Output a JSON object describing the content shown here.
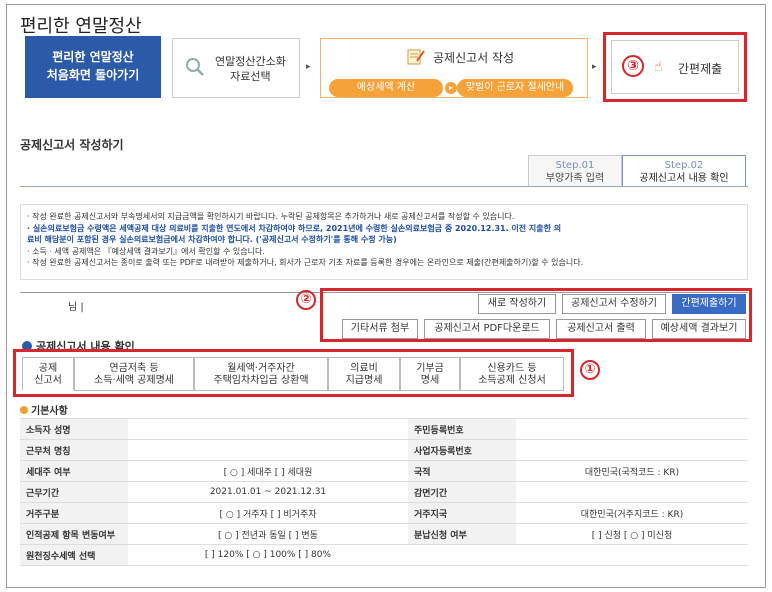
{
  "app_title": "편리한 연말정산",
  "home_button": {
    "line1": "편리한 연말정산",
    "line2": "처음화면 돌아가기"
  },
  "steps": {
    "step1": {
      "line1": "연말정산간소화",
      "line2": "자료선택",
      "icon": "magnifier-icon"
    },
    "step2": {
      "label": "공제신고서 작성",
      "sub1": "예상세액 계산",
      "sub2": "맞벌이 근로자 절세안내",
      "icon": "memo-icon"
    },
    "step3": {
      "num": "③",
      "label": "간편제출",
      "icon": "hand-pointer-icon"
    }
  },
  "arrow_glyph": "▸",
  "section_title": "공제신고서 작성하기",
  "tabs": [
    {
      "step": "Step.01",
      "label": "부양가족 입력"
    },
    {
      "step": "Step.02",
      "label": "공제신고서 내용 확인"
    }
  ],
  "notice": {
    "line1": "· 작성 완료한 공제신고서와 부속명세서의 지급금액을 확인하시기 바랍니다. 누락된 공제항목은 추가하거나 새로 공제신고서를 작성할 수 있습니다.",
    "line2": "· 실손의료보험금 수령액은 세액공제 대상 의료비를 지출한 연도에서 차감하여야 하므로, 2021년에 수령한 실손의료보험금 중 2020.12.31. 이전 지출한 의",
    "line3": "  료비 해당분이 포함된 경우 실손의료보험금에서 차감하여야 합니다. ('공제신고서 수정하기'를 통해 수정 가능)",
    "line4": "· 소득 · 세액 공제액은 『예상세액 결과보기』에서 확인할 수 있습니다.",
    "line5": "· 작성 완료한 공제신고서는 종이로 출력 또는 PDF로 내려받아 제출하거나, 회사가 근로자 기초 자료를 등록한 경우에는 온라인으로 제출(간편제출하기)할 수 있습니다."
  },
  "user_suffix": "님 |",
  "buttons_row1": [
    "새로 작성하기",
    "공제신고서 수정하기",
    "간편제출하기"
  ],
  "buttons_row2": [
    "기타서류 첨부",
    "공제신고서 PDF다운로드",
    "공제신고서 출력",
    "예상세액 결과보기"
  ],
  "marker2": "②",
  "marker1": "①",
  "sub_title": "공제신고서 내용 확인",
  "detail_tabs": [
    {
      "l1": "공제",
      "l2": "신고서"
    },
    {
      "l1": "연금저축 등",
      "l2": "소득·세액 공제명세"
    },
    {
      "l1": "월세액·거주자간",
      "l2": "주택임차차입금 상환액"
    },
    {
      "l1": "의료비",
      "l2": "지급명세"
    },
    {
      "l1": "기부금",
      "l2": "명세"
    },
    {
      "l1": "신용카드 등",
      "l2": "소득공제 신청서"
    }
  ],
  "basic_title": "기본사항",
  "info_rows": [
    {
      "h1": "소득자 성명",
      "v1": "",
      "h2": "주민등록번호",
      "v2": ""
    },
    {
      "h1": "근무처 명칭",
      "v1": "",
      "h2": "사업자등록번호",
      "v2": ""
    },
    {
      "h1": "세대주 여부",
      "v1": "[ ○ ] 세대주  [  ] 세대원",
      "h2": "국적",
      "v2": "대한민국(국적코드 : KR)"
    },
    {
      "h1": "근무기간",
      "v1": "2021.01.01 ~ 2021.12.31",
      "h2": "감면기간",
      "v2": ""
    },
    {
      "h1": "거주구분",
      "v1": "[ ○ ] 거주자  [  ] 비거주자",
      "h2": "거주지국",
      "v2": "대한민국(거주지코드 : KR)"
    },
    {
      "h1": "인적공제 항목 변동여부",
      "v1": "[ ○ ] 전년과 동일  [  ] 변동",
      "h2": "분납신청 여부",
      "v2": "[  ] 신청 [ ○ ] 미신청"
    },
    {
      "h1": "원천징수세액 선택",
      "v1": "[  ] 120% [ ○ ] 100% [  ] 80%",
      "h2": "",
      "v2": ""
    }
  ]
}
